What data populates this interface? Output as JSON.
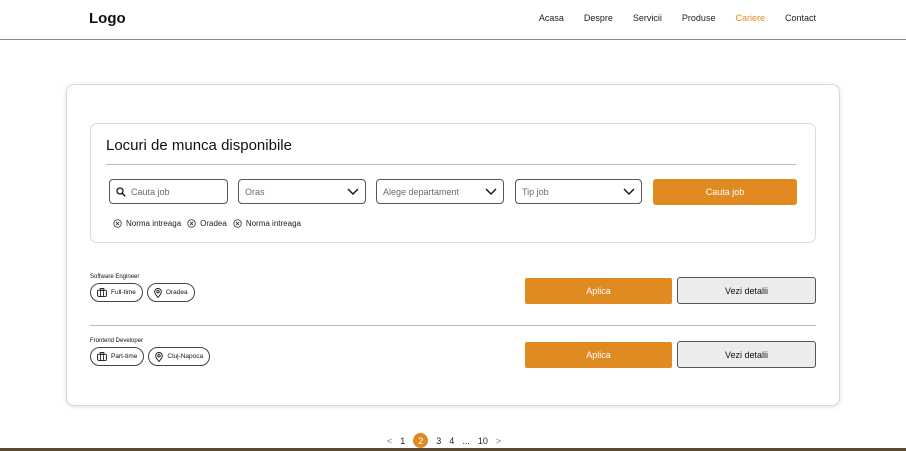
{
  "header": {
    "logo": "Logo",
    "nav": [
      {
        "label": "Acasa",
        "active": false
      },
      {
        "label": "Despre",
        "active": false
      },
      {
        "label": "Servicii",
        "active": false
      },
      {
        "label": "Produse",
        "active": false
      },
      {
        "label": "Cariere",
        "active": true
      },
      {
        "label": "Contact",
        "active": false
      }
    ]
  },
  "search": {
    "title": "Locuri de munca disponibile",
    "job_placeholder": "Cauta job",
    "city_placeholder": "Oras",
    "department_placeholder": "Alege departament",
    "type_placeholder": "Tip job",
    "button_label": "Cauta job",
    "active_filters": [
      "Norma intreaga",
      "Oradea",
      "Norma intreaga"
    ]
  },
  "jobs": [
    {
      "title": "Software Engineer",
      "type": "Full-time",
      "location": "Oradea",
      "apply_label": "Aplica",
      "details_label": "Vezi detalii"
    },
    {
      "title": "Frontend Developer",
      "type": "Part-time",
      "location": "Cluj-Napoca",
      "apply_label": "Aplica",
      "details_label": "Vezi detalii"
    }
  ],
  "pagination": {
    "prev": "<",
    "pages": [
      "1",
      "2",
      "3",
      "4"
    ],
    "ellipsis": "...",
    "last": "10",
    "next": ">",
    "current": "2"
  },
  "colors": {
    "accent": "#e08b22",
    "text": "#111111",
    "border": "#555555"
  },
  "icons": {
    "search": "search-icon",
    "chevron": "chevron-down-icon",
    "remove": "close-circle-icon",
    "job_type": "briefcase-icon",
    "location": "map-pin-icon"
  }
}
